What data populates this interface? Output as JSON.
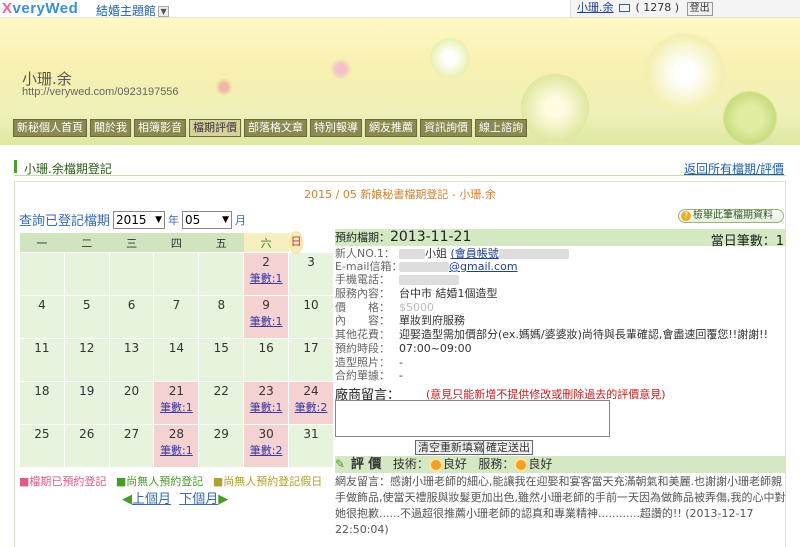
{
  "topbar": {
    "logo": "veryWed",
    "logo_prefix": "X",
    "theme_link": "結婚主題館",
    "user_name": "小珊.余",
    "mail_count": "( 1278 )",
    "logout": "登出"
  },
  "banner": {
    "name": "小珊.余",
    "url": "http://verywed.com/0923197556",
    "nav": [
      "新秘個人首頁",
      "關於我",
      "相簿影音",
      "檔期評價",
      "部落格文章",
      "特別報導",
      "網友推薦",
      "資訊詢價",
      "線上諮詢"
    ],
    "active_nav": "檔期評價"
  },
  "section": {
    "title": "小珊.余檔期登記",
    "back_link": "返回所有檔期/評價",
    "subtitle": "2015 / 05 新娘秘書檔期登記 - 小珊.余"
  },
  "query": {
    "label": "查詢已登記檔期",
    "year": "2015",
    "year_unit": "年",
    "month": "05",
    "month_unit": "月",
    "detail_button": "檢舉此筆檔期資料"
  },
  "calendar": {
    "weekdays": [
      "一",
      "二",
      "三",
      "四",
      "五",
      "六",
      "日"
    ],
    "weeks": [
      [
        {
          "d": ""
        },
        {
          "d": ""
        },
        {
          "d": ""
        },
        {
          "d": ""
        },
        {
          "d": ""
        },
        {
          "d": "2",
          "link": "筆數:1"
        },
        {
          "d": "3"
        }
      ],
      [
        {
          "d": "4"
        },
        {
          "d": "5"
        },
        {
          "d": "6"
        },
        {
          "d": "7"
        },
        {
          "d": "8"
        },
        {
          "d": "9",
          "link": "筆數:1"
        },
        {
          "d": "10"
        }
      ],
      [
        {
          "d": "11"
        },
        {
          "d": "12"
        },
        {
          "d": "13"
        },
        {
          "d": "14"
        },
        {
          "d": "15"
        },
        {
          "d": "16"
        },
        {
          "d": "17"
        }
      ],
      [
        {
          "d": "18"
        },
        {
          "d": "19"
        },
        {
          "d": "20"
        },
        {
          "d": "21",
          "link": "筆數:1"
        },
        {
          "d": "22"
        },
        {
          "d": "23",
          "link": "筆數:1"
        },
        {
          "d": "24",
          "link": "筆數:2"
        }
      ],
      [
        {
          "d": "25"
        },
        {
          "d": "26"
        },
        {
          "d": "27"
        },
        {
          "d": "28",
          "link": "筆數:1"
        },
        {
          "d": "29"
        },
        {
          "d": "30",
          "link": "筆數:2"
        },
        {
          "d": "31"
        }
      ]
    ],
    "legend": [
      "■檔期已預約登記",
      "■尚無人預約登記",
      "■尚無人預約登記假日"
    ],
    "prev": "上個月",
    "next": "下個月"
  },
  "booking": {
    "date_label": "預約檔期：",
    "date": "2013-11-21",
    "count_label": "當日筆數：",
    "count": "1",
    "new_person_label": "新人NO.1：",
    "new_person": "小姐",
    "member_account": "(會員帳號",
    "email_label": "E-mail信箱：",
    "email": "@gmail.com",
    "phone_label": "手機電話：",
    "service_label": "服務內容：",
    "service": "台中市 結婚1個造型",
    "price_label": "價　　格：",
    "price": "$5000",
    "content_label": "內　　容：",
    "content": "單妝到府服務",
    "other_label": "其他花費：",
    "other": "迎娶造型需加價部分(ex.媽媽/婆婆妝)尚待與長輩確認,會盡速回覆您!!謝謝!!",
    "time_label": "預約時段：",
    "time": "07:00~09:00",
    "photo_label": "造型照片：",
    "photo": "-",
    "contract_label": "合約單據：",
    "contract": "-"
  },
  "comment": {
    "label": "廠商留言：",
    "warning": "(意見只能新增不提供修改或刪除過去的評價意見)",
    "clear_btn": "清空重新填寫",
    "submit_btn": "確定送出"
  },
  "review": {
    "label": "評 價",
    "tech_label": "技術：",
    "tech_value": "良好",
    "service_label": "服務：",
    "service_value": "良好",
    "text": "網友留言：感謝小珊老師的細心,能讓我在迎娶和宴客當天充滿朝氣和美麗.也謝謝小珊老師親手做飾品,使當天禮服與妝髮更加出色,雖然小珊老師的手前一天因為做飾品被弄傷,我的心中對她很抱歉......不過超很推薦小珊老師的認真和專業精神............超讚的!!",
    "timestamp": "(2013-12-17 22:50:04)"
  }
}
